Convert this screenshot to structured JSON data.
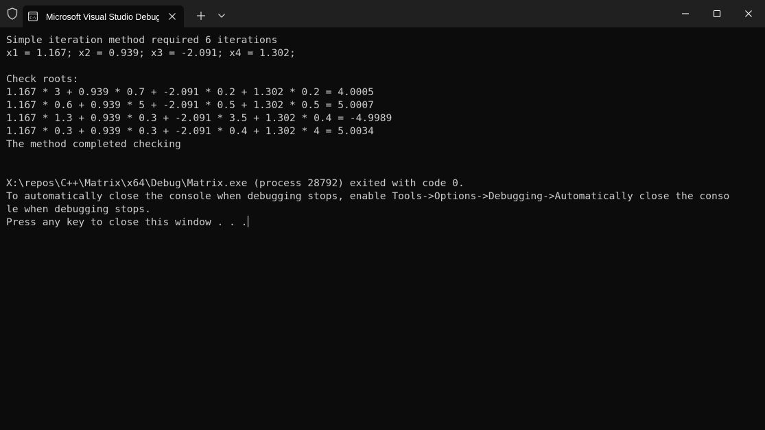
{
  "titlebar": {
    "tab_title": "Microsoft Visual Studio Debug Console",
    "icons": {
      "shield": "shield-icon",
      "tab": "console-icon",
      "close_tab": "close-icon",
      "new_tab": "plus-icon",
      "dropdown": "chevron-down-icon",
      "minimize": "minimize-icon",
      "maximize": "maximize-icon",
      "close_window": "close-icon"
    }
  },
  "console": {
    "lines": [
      "Simple iteration method required 6 iterations",
      "x1 = 1.167; x2 = 0.939; x3 = -2.091; x4 = 1.302;",
      "",
      "Check roots:",
      "1.167 * 3 + 0.939 * 0.7 + -2.091 * 0.2 + 1.302 * 0.2 = 4.0005",
      "1.167 * 0.6 + 0.939 * 5 + -2.091 * 0.5 + 1.302 * 0.5 = 5.0007",
      "1.167 * 1.3 + 0.939 * 0.3 + -2.091 * 3.5 + 1.302 * 0.4 = -4.9989",
      "1.167 * 0.3 + 0.939 * 0.3 + -2.091 * 0.4 + 1.302 * 4 = 5.0034",
      "The method completed checking",
      "",
      "",
      "X:\\repos\\C++\\Matrix\\x64\\Debug\\Matrix.exe (process 28792) exited with code 0.",
      "To automatically close the console when debugging stops, enable Tools->Options->Debugging->Automatically close the conso",
      "le when debugging stops.",
      "Press any key to close this window . . ."
    ]
  },
  "colors": {
    "background": "#0c0c0c",
    "titlebar": "#202020",
    "text": "#cccccc"
  }
}
